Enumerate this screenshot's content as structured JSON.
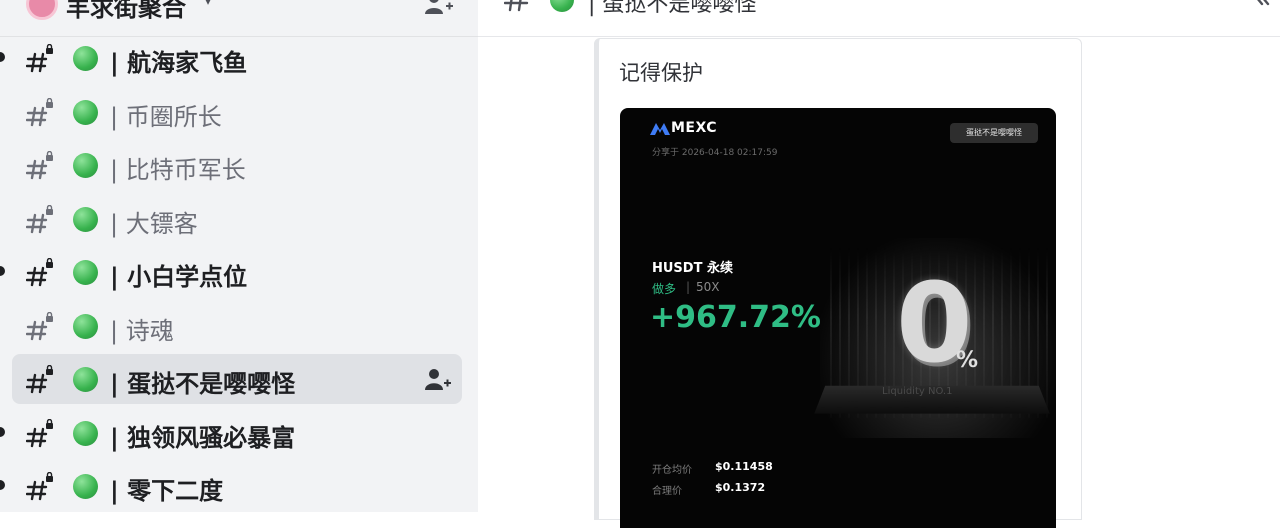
{
  "sidebar": {
    "server_name": "羊求街聚合",
    "channels": [
      {
        "name": "| 航海家飞鱼",
        "unread": true
      },
      {
        "name": "| 币圈所长",
        "unread": false
      },
      {
        "name": "| 比特币军长",
        "unread": false
      },
      {
        "name": "| 大镖客",
        "unread": false
      },
      {
        "name": "| 小白学点位",
        "unread": true
      },
      {
        "name": "| 诗魂",
        "unread": false
      },
      {
        "name": "| 蛋挞不是嘤嘤怪",
        "unread": false,
        "selected": true
      },
      {
        "name": "| 独领风骚必暴富",
        "unread": true
      },
      {
        "name": "| 零下二度",
        "unread": true
      }
    ]
  },
  "header": {
    "title": "| 蛋挞不是嘤嘤怪"
  },
  "message": {
    "text": "记得保护",
    "share_card": {
      "brand": "MEXC",
      "share_time": "分享于 2026-04-18 02:17:59",
      "user_badge": "蛋挞不是嘤嘤怪",
      "pair": "HUSDT 永续",
      "direction": "做多",
      "separator": "|",
      "leverage": "50X",
      "pnl": "+967.72%",
      "promo_big": "0",
      "promo_pct": "%",
      "promo_caption": "Liquidity NO.1",
      "stats": [
        {
          "label": "开仓均价",
          "value": "$0.11458"
        },
        {
          "label": "合理价",
          "value": "$0.1372"
        }
      ]
    }
  },
  "colors": {
    "sidebar_bg": "#f2f3f5",
    "selected_bg": "#dfe1e5",
    "channel_dot": "#37b24d",
    "pnl_green": "#2fbd85",
    "card_bg": "#050505"
  },
  "icons": {
    "channel": "hash-lock-icon",
    "add_member": "add-member-icon",
    "status": "green-dot-icon"
  }
}
